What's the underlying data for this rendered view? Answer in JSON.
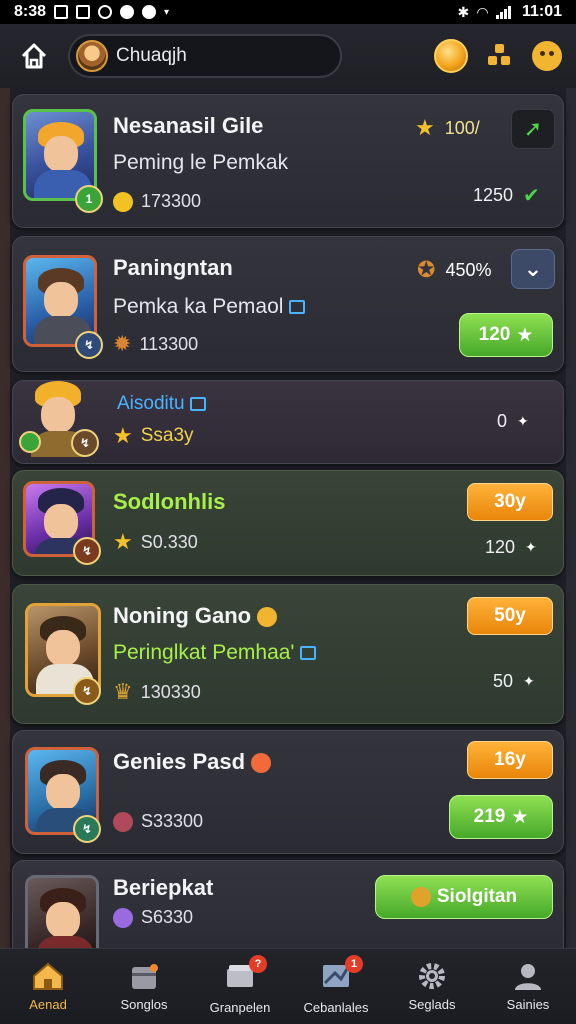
{
  "status_bar": {
    "time": "8:38",
    "clock": "11:01"
  },
  "header": {
    "search_value": "Chuaqjh"
  },
  "cards": [
    {
      "title": "Nesanasil Gile",
      "subtitle": "Peming le Pemkak",
      "stat": "173300",
      "rate": "100/",
      "count": "1250"
    },
    {
      "title": "Paningntan",
      "subtitle": "Pemka ka Pemaol",
      "stat": "113300",
      "rate": "450%",
      "button": "120"
    },
    {
      "title": "Aisoditu",
      "stat": "Ssa3y",
      "count": "0"
    },
    {
      "title": "Sodlonhlis",
      "stat": "S0.330",
      "button": "30y",
      "count": "120"
    },
    {
      "title": "Noning Gano",
      "subtitle": "Peringlkat Pemhaa'",
      "stat": "130330",
      "button": "50y",
      "count": "50"
    },
    {
      "title": "Genies Pasd",
      "stat": "S33300",
      "button": "16y",
      "green_button": "219"
    },
    {
      "title": "Beriepkat",
      "stat": "S6330",
      "green_button": "Siolgitan"
    }
  ],
  "bottom_nav": [
    {
      "label": "Aenad",
      "active": true
    },
    {
      "label": "Songlos"
    },
    {
      "label": "Granpelen",
      "badge": "?"
    },
    {
      "label": "Cebanlales",
      "badge": "1"
    },
    {
      "label": "Seglads"
    },
    {
      "label": "Sainies"
    }
  ],
  "colors": {
    "accent_orange": "#f4b84a",
    "green": "#4fd34a",
    "gold": "#f5c12a"
  }
}
